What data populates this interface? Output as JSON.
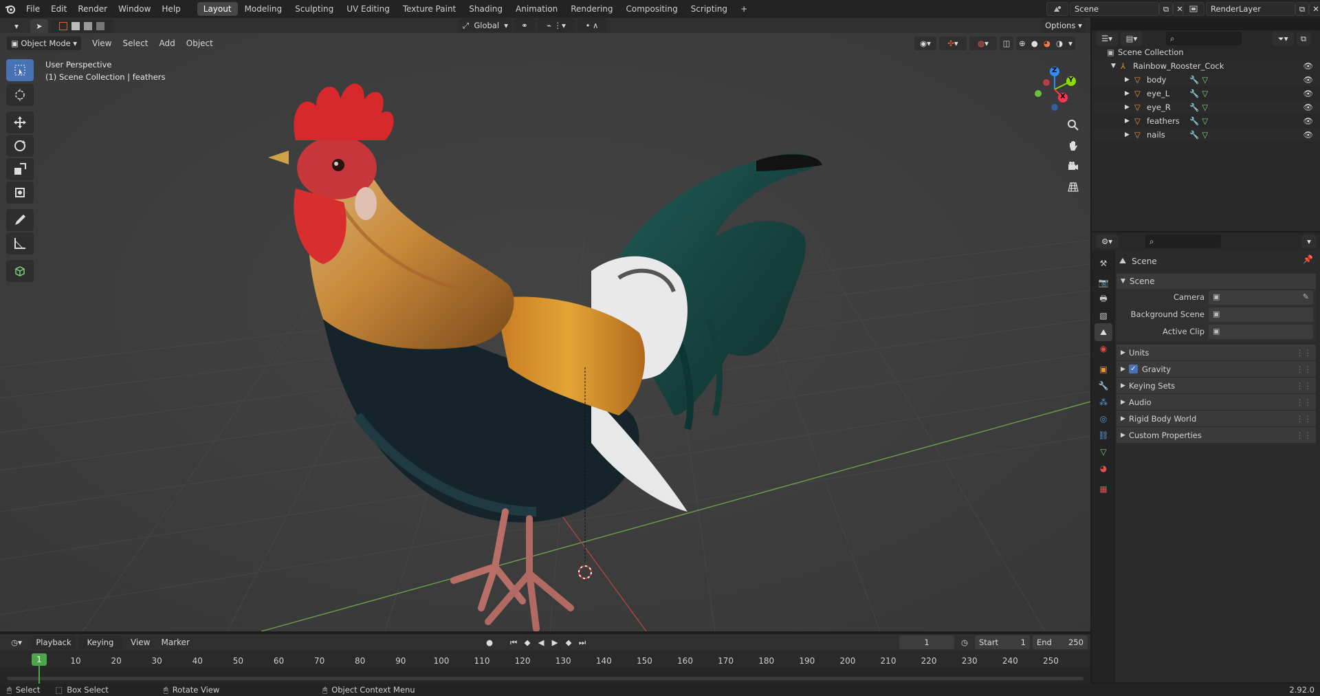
{
  "menus": [
    "File",
    "Edit",
    "Render",
    "Window",
    "Help"
  ],
  "workspaces": [
    {
      "label": "Layout",
      "active": true
    },
    {
      "label": "Modeling"
    },
    {
      "label": "Sculpting"
    },
    {
      "label": "UV Editing"
    },
    {
      "label": "Texture Paint"
    },
    {
      "label": "Shading"
    },
    {
      "label": "Animation"
    },
    {
      "label": "Rendering"
    },
    {
      "label": "Compositing"
    },
    {
      "label": "Scripting"
    }
  ],
  "add_workspace": "+",
  "scene_name": "Scene",
  "render_layer": "RenderLayer",
  "viewport_header": {
    "mode": "Object Mode",
    "menus": [
      "View",
      "Select",
      "Add",
      "Object"
    ],
    "orientation": "Global",
    "options": "Options"
  },
  "viewport_overlay": {
    "perspective": "User Perspective",
    "collection_info": "(1) Scene Collection | feathers"
  },
  "gizmo_axes": {
    "z": "Z",
    "y": "Y",
    "x": "X"
  },
  "outliner": {
    "root": "Scene Collection",
    "collection": "Rainbow_Rooster_Cock",
    "objects": [
      "body",
      "eye_L",
      "eye_R",
      "feathers",
      "nails"
    ]
  },
  "properties": {
    "context_title": "Scene",
    "panel_title": "Scene",
    "fields": [
      {
        "label": "Camera"
      },
      {
        "label": "Background Scene"
      },
      {
        "label": "Active Clip"
      }
    ],
    "sections": [
      {
        "label": "Units",
        "checkbox": false
      },
      {
        "label": "Gravity",
        "checkbox": true,
        "checked": true
      },
      {
        "label": "Keying Sets",
        "checkbox": false
      },
      {
        "label": "Audio",
        "checkbox": false
      },
      {
        "label": "Rigid Body World",
        "checkbox": false
      },
      {
        "label": "Custom Properties",
        "checkbox": false
      }
    ]
  },
  "timeline": {
    "menus": [
      "Playback",
      "Keying",
      "View",
      "Marker"
    ],
    "current_frame": "1",
    "start_label": "Start",
    "start_value": "1",
    "end_label": "End",
    "end_value": "250",
    "ticks": [
      "10",
      "20",
      "30",
      "40",
      "50",
      "60",
      "70",
      "80",
      "90",
      "100",
      "110",
      "120",
      "130",
      "140",
      "150",
      "160",
      "170",
      "180",
      "190",
      "200",
      "210",
      "220",
      "230",
      "240",
      "250"
    ],
    "playhead_label": "1"
  },
  "statusbar": {
    "select": "Select",
    "box_select": "Box Select",
    "rotate_view": "Rotate View",
    "context_menu": "Object Context Menu",
    "version": "2.92.0"
  },
  "colors": {
    "accent": "#4772b3",
    "object_icon": "#e8953a",
    "x_axis": "#ff3352",
    "y_axis": "#8bdc00",
    "z_axis": "#2890ff"
  }
}
